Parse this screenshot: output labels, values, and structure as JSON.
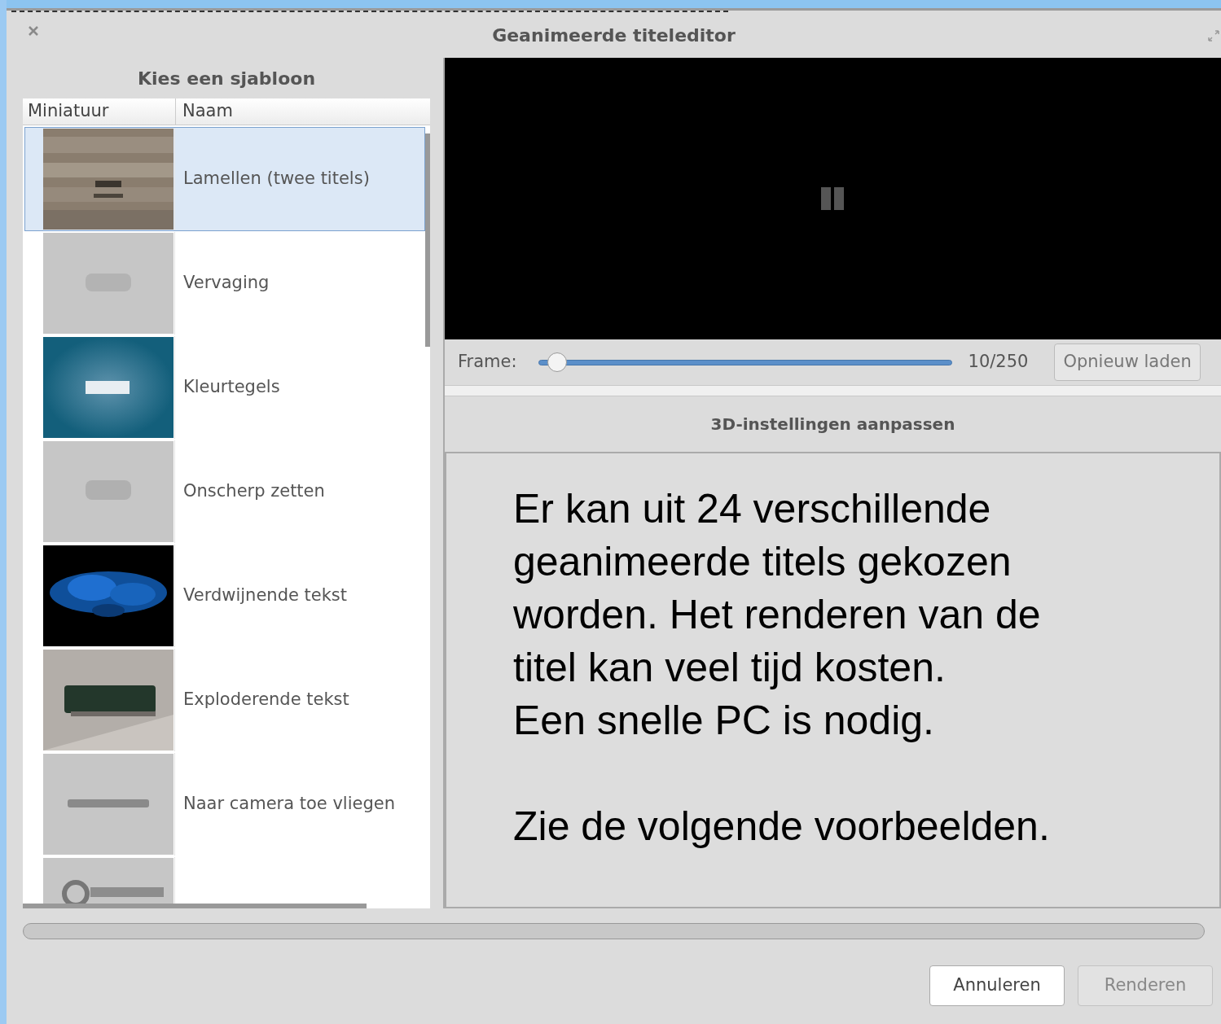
{
  "window": {
    "title": "Geanimeerde titeleditor"
  },
  "templates": {
    "heading": "Kies een sjabloon",
    "columns": [
      "Miniatuur",
      "Naam"
    ],
    "rows": [
      {
        "name": "Lamellen (twee titels)",
        "selected": true
      },
      {
        "name": "Vervaging",
        "selected": false
      },
      {
        "name": "Kleurtegels",
        "selected": false
      },
      {
        "name": "Onscherp zetten",
        "selected": false
      },
      {
        "name": "Verdwijnende tekst",
        "selected": false
      },
      {
        "name": "Exploderende tekst",
        "selected": false
      },
      {
        "name": "Naar camera toe vliegen",
        "selected": false
      },
      {
        "selected": false
      }
    ]
  },
  "preview": {
    "frame_label": "Frame:",
    "frame": {
      "level": 0.04
    },
    "frame_reading": "10/250",
    "reload_button": "Opnieuw laden"
  },
  "settings": {
    "heading": "3D-instellingen aanpassen",
    "description": "Er kan uit 24 verschillende\ngeanimeerde titels gekozen\nworden. Het renderen van de\ntitel kan veel tijd kosten.\nEen snelle PC is nodig.\n\nZie de volgende voorbeelden."
  },
  "progress": {
    "level": 0
  },
  "buttons": [
    {
      "label": "Annuleren",
      "disabled": false
    },
    {
      "label": "Renderen",
      "disabled": true
    }
  ]
}
